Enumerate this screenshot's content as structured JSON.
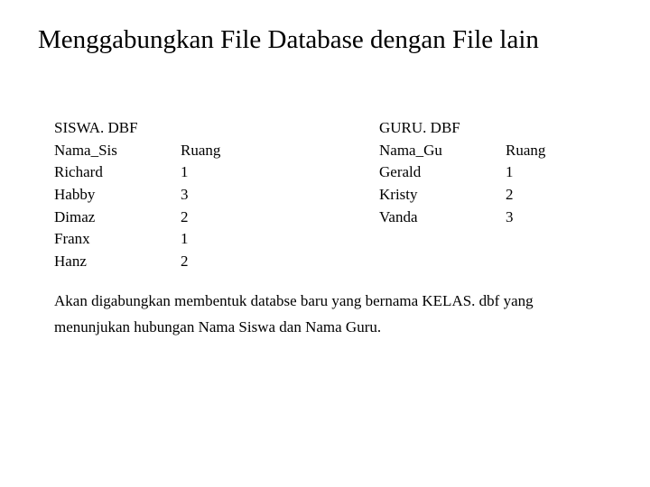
{
  "title": "Menggabungkan File Database dengan File lain",
  "siswa": {
    "file": "SISWA. DBF",
    "nameHeader": "Nama_Sis",
    "ruangHeader": "Ruang",
    "rows": [
      {
        "name": "Richard",
        "ruang": "1"
      },
      {
        "name": "Habby",
        "ruang": "3"
      },
      {
        "name": "Dimaz",
        "ruang": "2"
      },
      {
        "name": "Franx",
        "ruang": "1"
      },
      {
        "name": "Hanz",
        "ruang": "2"
      }
    ]
  },
  "guru": {
    "file": "GURU. DBF",
    "nameHeader": "Nama_Gu",
    "ruangHeader": "Ruang",
    "rows": [
      {
        "name": "Gerald",
        "ruang": "1"
      },
      {
        "name": "Kristy",
        "ruang": "2"
      },
      {
        "name": "Vanda",
        "ruang": "3"
      }
    ]
  },
  "description": "Akan digabungkan membentuk databse baru yang bernama KELAS. dbf yang menunjukan hubungan Nama Siswa dan Nama Guru."
}
